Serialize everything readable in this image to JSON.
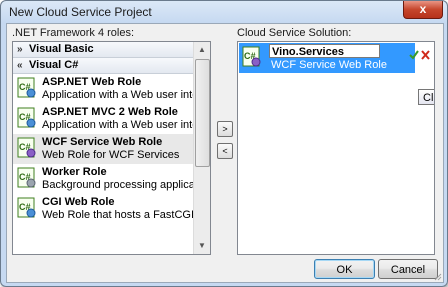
{
  "window": {
    "title": "New Cloud Service Project",
    "close_glyph": "x"
  },
  "roles_panel": {
    "label": ".NET Framework 4 roles:",
    "groups": [
      {
        "name": "Visual Basic",
        "expanded": false
      },
      {
        "name": "Visual C#",
        "expanded": true
      }
    ],
    "items": [
      {
        "name": "ASP.NET Web Role",
        "description": "Application with a Web user interface",
        "icon": "web-role-icon"
      },
      {
        "name": "ASP.NET MVC 2 Web Role",
        "description": "Application with a Web user interface usi...",
        "icon": "mvc-role-icon"
      },
      {
        "name": "WCF Service Web Role",
        "description": "Web Role for WCF Services",
        "icon": "wcf-role-icon",
        "selected": true
      },
      {
        "name": "Worker Role",
        "description": "Background processing application",
        "icon": "worker-role-icon"
      },
      {
        "name": "CGI Web Role",
        "description": "Web Role that hosts a FastCGI Application",
        "icon": "cgi-role-icon"
      }
    ]
  },
  "move_buttons": {
    "add": ">",
    "remove": "<"
  },
  "solution_panel": {
    "label": "Cloud Service Solution:",
    "items": [
      {
        "name_value": "Vino.Services",
        "description": "WCF Service Web Role"
      }
    ],
    "tooltip": "Click to"
  },
  "buttons": {
    "ok": "OK",
    "cancel": "Cancel"
  },
  "colors": {
    "selection": "#3399ff",
    "title_bar": "#c6d9f1",
    "close": "#c6462c"
  }
}
